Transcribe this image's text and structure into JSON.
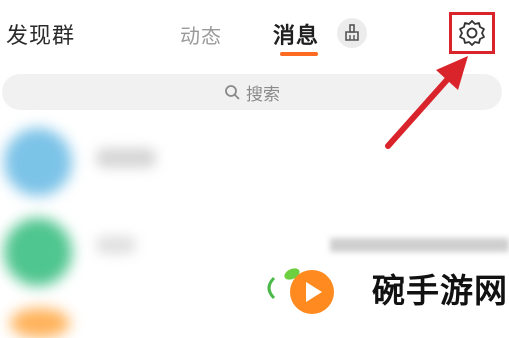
{
  "header": {
    "discover_label": "发现群",
    "tabs": [
      {
        "label": "动态",
        "active": false
      },
      {
        "label": "消息",
        "active": true
      }
    ],
    "active_color": "#ff6a22",
    "clean_icon": "broom-icon",
    "settings_icon": "gear-icon",
    "highlight_color": "#d9242b"
  },
  "search": {
    "icon": "search-icon",
    "placeholder": "搜索"
  },
  "watermark": {
    "text": "碗手游网"
  }
}
